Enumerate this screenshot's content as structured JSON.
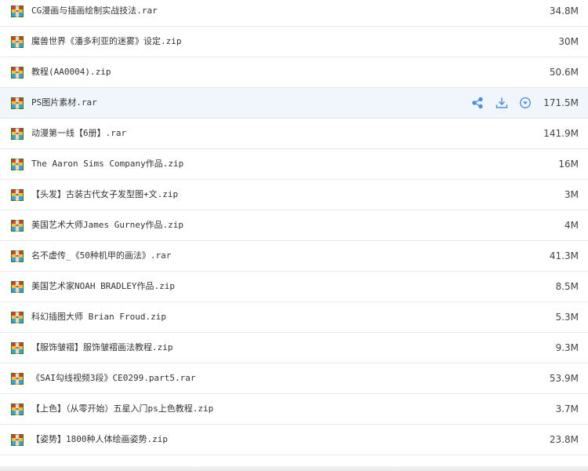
{
  "files": [
    {
      "name": "CG漫画与插画绘制实战技法.rar",
      "size": "34.8M",
      "icon": "archive-icon"
    },
    {
      "name": "魔兽世界《潘多利亚的迷雾》设定.zip",
      "size": "30M",
      "icon": "archive-icon"
    },
    {
      "name": "教程(AA0004).zip",
      "size": "50.6M",
      "icon": "archive-icon"
    },
    {
      "name": "PS图片素材.rar",
      "size": "171.5M",
      "icon": "archive-icon",
      "hovered": true
    },
    {
      "name": "动漫第一线【6册】.rar",
      "size": "141.9M",
      "icon": "archive-icon"
    },
    {
      "name": "The Aaron Sims Company作品.zip",
      "size": "16M",
      "icon": "archive-icon"
    },
    {
      "name": "【头发】古装古代女子发型图+文.zip",
      "size": "3M",
      "icon": "archive-icon"
    },
    {
      "name": "美国艺术大师James Gurney作品.zip",
      "size": "4M",
      "icon": "archive-icon"
    },
    {
      "name": "名不虚传_《50种机甲的画法》.rar",
      "size": "41.3M",
      "icon": "archive-icon"
    },
    {
      "name": "美国艺术家NOAH BRADLEY作品.zip",
      "size": "8.5M",
      "icon": "archive-icon"
    },
    {
      "name": "科幻插图大师 Brian Froud.zip",
      "size": "5.3M",
      "icon": "archive-icon"
    },
    {
      "name": "【服饰皱褶】服饰皱褶画法教程.zip",
      "size": "9.3M",
      "icon": "archive-icon"
    },
    {
      "name": "《SAI勾线视频3段》CE0299.part5.rar",
      "size": "53.9M",
      "icon": "archive-icon"
    },
    {
      "name": "【上色】（从零开始）五星入门ps上色教程.zip",
      "size": "3.7M",
      "icon": "archive-icon"
    },
    {
      "name": "【姿势】1800种人体绘画姿势.zip",
      "size": "23.8M",
      "icon": "archive-icon"
    }
  ],
  "row_actions": [
    "share-icon",
    "download-icon",
    "more-icon"
  ],
  "colors": {
    "accent": "#4a90e2",
    "hover_bg": "#f1f6fd",
    "divider": "#e8eaed"
  }
}
